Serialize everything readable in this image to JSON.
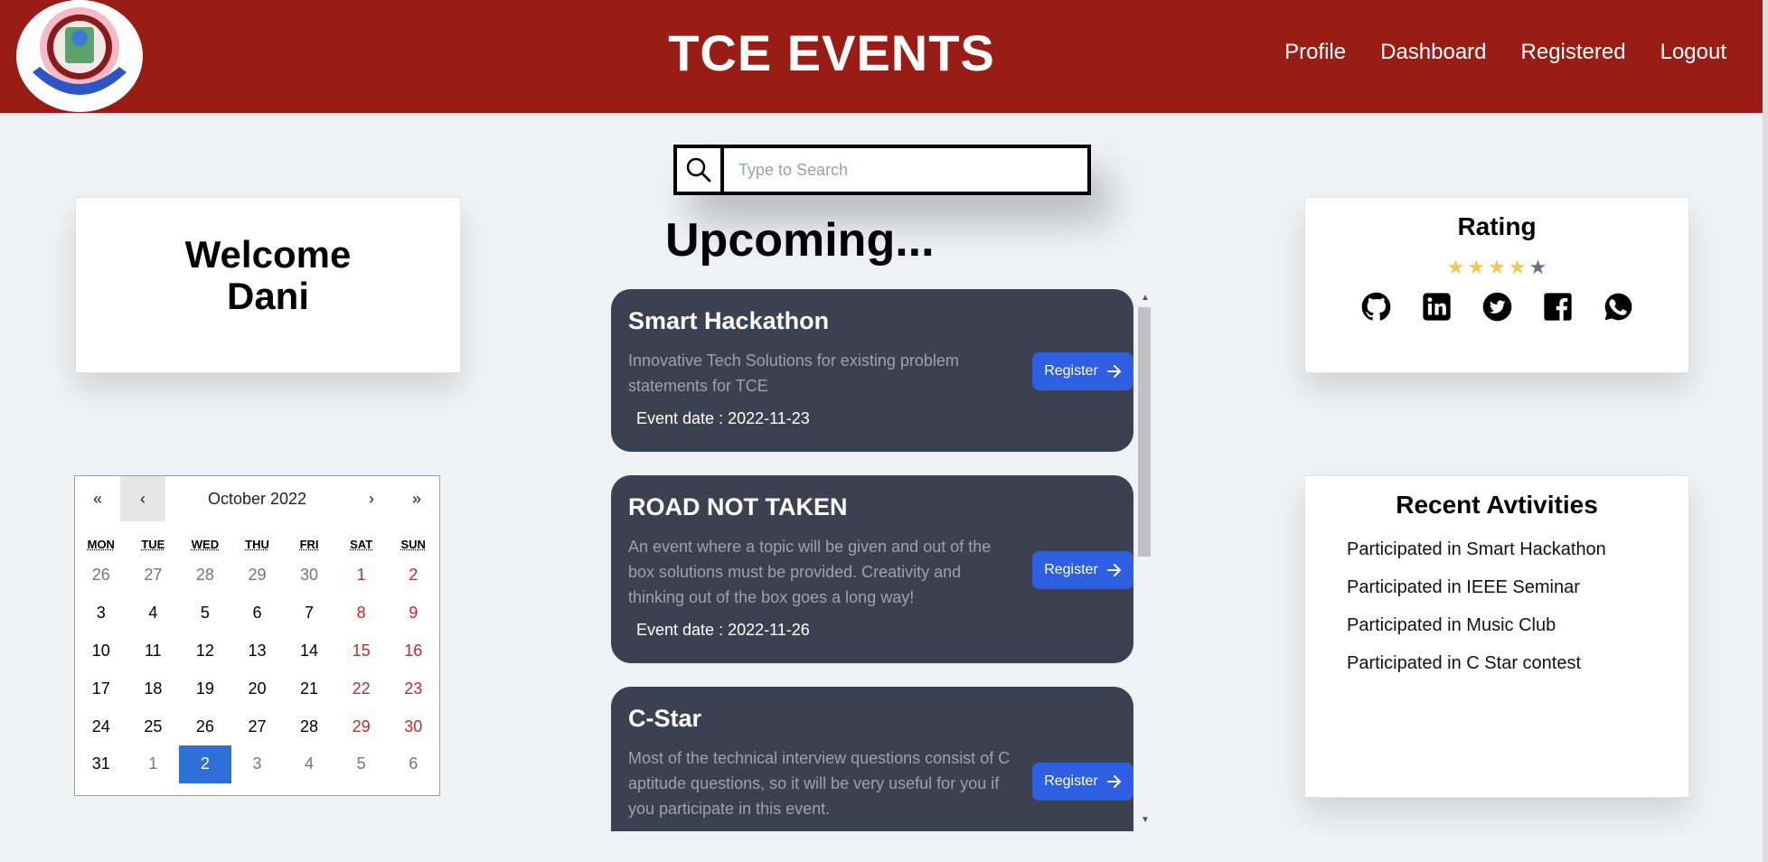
{
  "header": {
    "title": "TCE EVENTS",
    "nav": [
      "Profile",
      "Dashboard",
      "Registered",
      "Logout"
    ]
  },
  "search": {
    "placeholder": "Type to Search",
    "value": ""
  },
  "welcome": {
    "line1": "Welcome",
    "line2": "Dani"
  },
  "calendar": {
    "month_label": "October 2022",
    "nav": {
      "first": "«",
      "prev": "‹",
      "next": "›",
      "last": "»"
    },
    "weekdays": [
      "MON",
      "TUE",
      "WED",
      "THU",
      "FRI",
      "SAT",
      "SUN"
    ],
    "days": [
      [
        "26",
        "27",
        "28",
        "29",
        "30",
        "1",
        "2"
      ],
      [
        "3",
        "4",
        "5",
        "6",
        "7",
        "8",
        "9"
      ],
      [
        "10",
        "11",
        "12",
        "13",
        "14",
        "15",
        "16"
      ],
      [
        "17",
        "18",
        "19",
        "20",
        "21",
        "22",
        "23"
      ],
      [
        "24",
        "25",
        "26",
        "27",
        "28",
        "29",
        "30"
      ],
      [
        "31",
        "1",
        "2",
        "3",
        "4",
        "5",
        "6"
      ]
    ],
    "selected": "2"
  },
  "upcoming": {
    "title": "Upcoming...",
    "events": [
      {
        "name": "Smart Hackathon",
        "desc": "Innovative Tech Solutions for existing problem statements for TCE",
        "date": "Event date : 2022-11-23",
        "button": "Register"
      },
      {
        "name": "ROAD NOT TAKEN",
        "desc": "An event where a topic will be given and out of the box solutions must be provided. Creativity and thinking out of the box goes a long way!",
        "date": "Event date : 2022-11-26",
        "button": "Register"
      },
      {
        "name": "C-Star",
        "desc": "Most of the technical interview questions consist of C aptitude questions, so it will be very useful for you if you participate in this event.",
        "date": "",
        "button": "Register"
      }
    ]
  },
  "rating": {
    "title": "Rating",
    "stars_filled": 4,
    "stars_total": 5,
    "socials": [
      "github-icon",
      "linkedin-icon",
      "twitter-icon",
      "facebook-icon",
      "whatsapp-icon"
    ]
  },
  "recent": {
    "title": "Recent Avtivities",
    "items": [
      "Participated in Smart Hackathon",
      "Participated in IEEE Seminar",
      "Participated in Music Club",
      "Participated in C Star contest"
    ]
  },
  "colors": {
    "header_bg": "#9a1d15",
    "page_bg": "#f0f1f5",
    "event_card_bg": "#3b4150",
    "button_bg": "#2e5fe0",
    "calendar_selected": "#2e6fd8",
    "weekend_red": "#c62828",
    "star_gold": "#f2c94c"
  }
}
